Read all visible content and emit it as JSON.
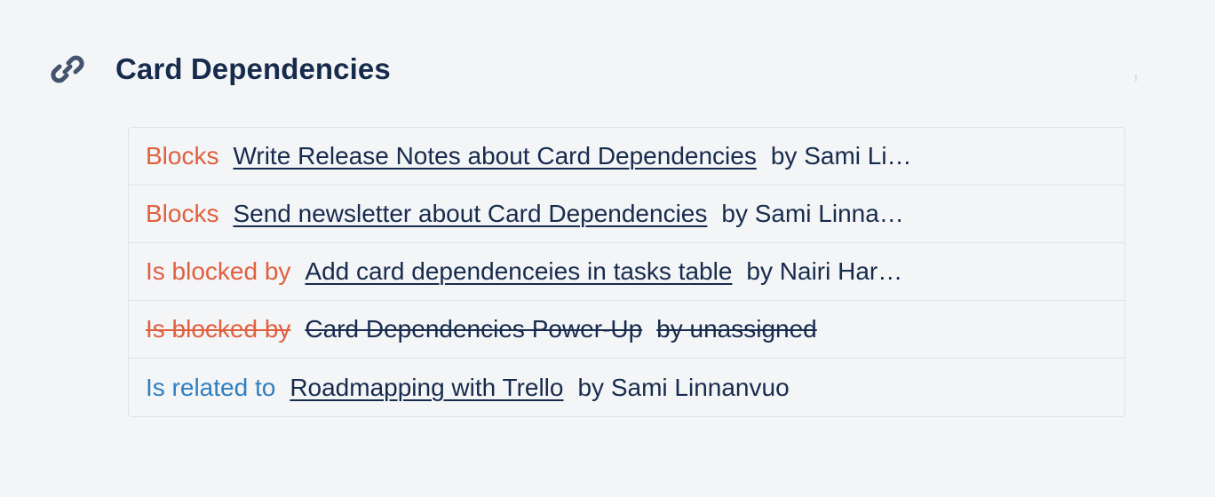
{
  "section": {
    "title": "Card Dependencies",
    "icon": "link-icon"
  },
  "colors": {
    "blocks": "#e0603f",
    "related": "#2f7fc1",
    "text": "#172b4d",
    "background": "#f4f5f7",
    "border": "#dfe1e6"
  },
  "dependencies": [
    {
      "type": "Blocks",
      "card": "Write Release Notes about Card Dependencies",
      "owner": "by Sami Li…"
    },
    {
      "type": "Blocks",
      "card": "Send newsletter about Card Dependencies",
      "owner": "by Sami Linna…"
    },
    {
      "type": "Is blocked by",
      "card": "Add card dependenceies in tasks table",
      "owner": "by Nairi Har…"
    },
    {
      "type": "Is blocked by",
      "card": "Card Dependencies Power-Up",
      "owner": "by unassigned",
      "completed": true
    },
    {
      "type": "Is related to",
      "card": "Roadmapping with Trello",
      "owner": "by Sami Linnanvuo"
    }
  ]
}
